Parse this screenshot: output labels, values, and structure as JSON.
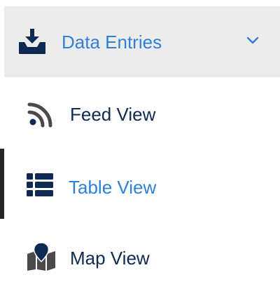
{
  "menu": {
    "group": {
      "label": "Data Entries",
      "icon": "download-tray-icon",
      "expanded": true,
      "label_color": "#2f80d9"
    },
    "items": [
      {
        "label": "Feed View",
        "icon": "rss-feed-icon",
        "active": false
      },
      {
        "label": "Table View",
        "icon": "table-list-icon",
        "active": true
      },
      {
        "label": "Map View",
        "icon": "map-pin-icon",
        "active": false
      }
    ]
  },
  "colors": {
    "accent": "#2f80d9",
    "text": "#0e2a52",
    "header_bg": "#ececec",
    "active_bar": "#262626",
    "icon_dark": "#0e2a52",
    "icon_gray": "#4a4a4a"
  }
}
